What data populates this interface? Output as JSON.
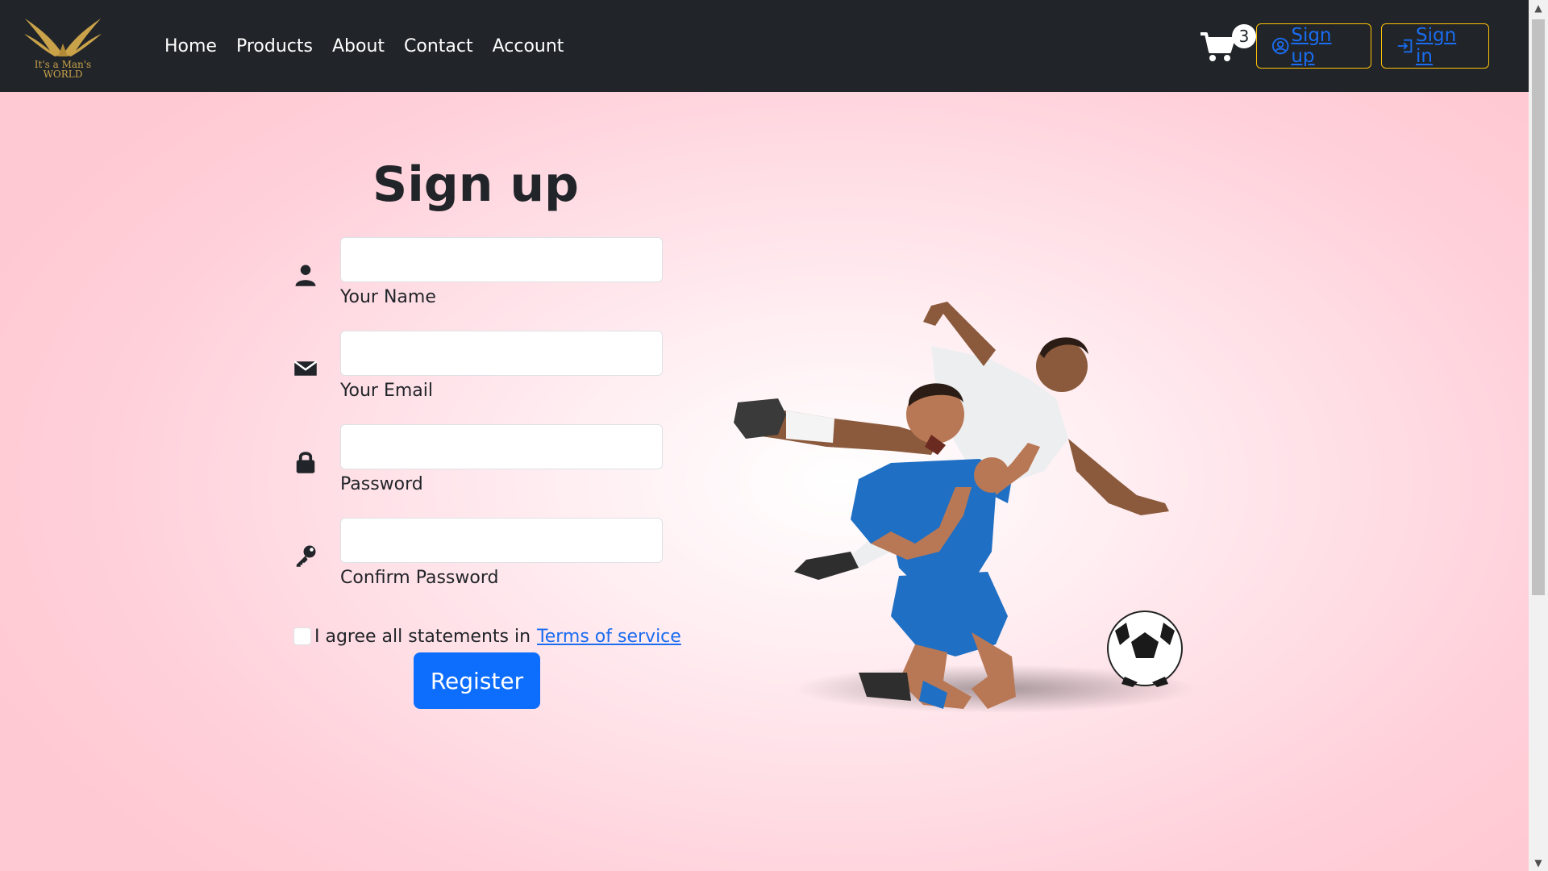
{
  "brand": {
    "logo_top": "It's a Man's",
    "logo_bottom": "WORLD",
    "accent": "#c9a24a"
  },
  "nav": {
    "links": [
      "Home",
      "Products",
      "About",
      "Contact",
      "Account"
    ],
    "cart_count": "3",
    "signup_label": "Sign up",
    "signin_label": "Sign in",
    "bg_color": "#212529",
    "button_border": "#ffc107",
    "link_color": "#1a6cf0"
  },
  "form": {
    "title": "Sign up",
    "fields": [
      {
        "label": "Your Name",
        "icon": "user-icon",
        "value": ""
      },
      {
        "label": "Your Email",
        "icon": "envelope-icon",
        "value": ""
      },
      {
        "label": "Password",
        "icon": "lock-icon",
        "value": ""
      },
      {
        "label": "Confirm Password",
        "icon": "key-icon",
        "value": ""
      }
    ],
    "agree_text": "I agree all statements in",
    "terms_link": "Terms of service",
    "agree_checked": false,
    "register_label": "Register",
    "register_color": "#0d6efd"
  },
  "hero_image": {
    "icon": "football-players-image"
  }
}
